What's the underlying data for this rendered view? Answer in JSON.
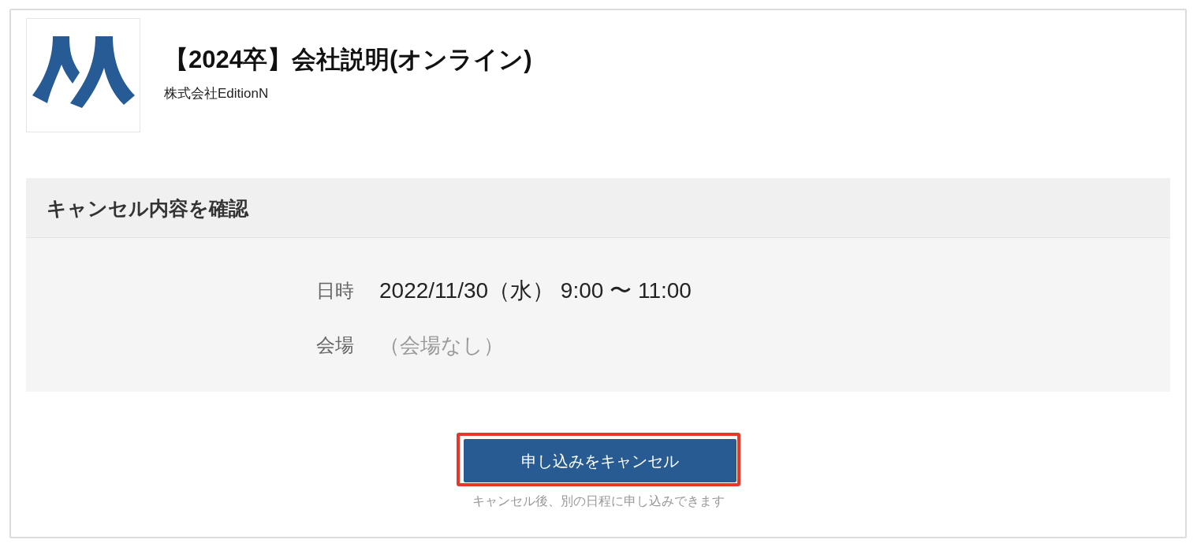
{
  "event": {
    "title": "【2024卒】会社説明(オンライン)",
    "company": "株式会社EditionN"
  },
  "confirmation": {
    "heading": "キャンセル内容を確認",
    "rows": [
      {
        "label": "日時",
        "value": "2022/11/30（水） 9:00 〜 11:00",
        "kind": "filled"
      },
      {
        "label": "会場",
        "value": "（会場なし）",
        "kind": "empty"
      }
    ]
  },
  "cancel_button": {
    "label": "申し込みをキャンセル",
    "highlighted": true
  },
  "note": "キャンセル後、別の日程に申し込みできます"
}
